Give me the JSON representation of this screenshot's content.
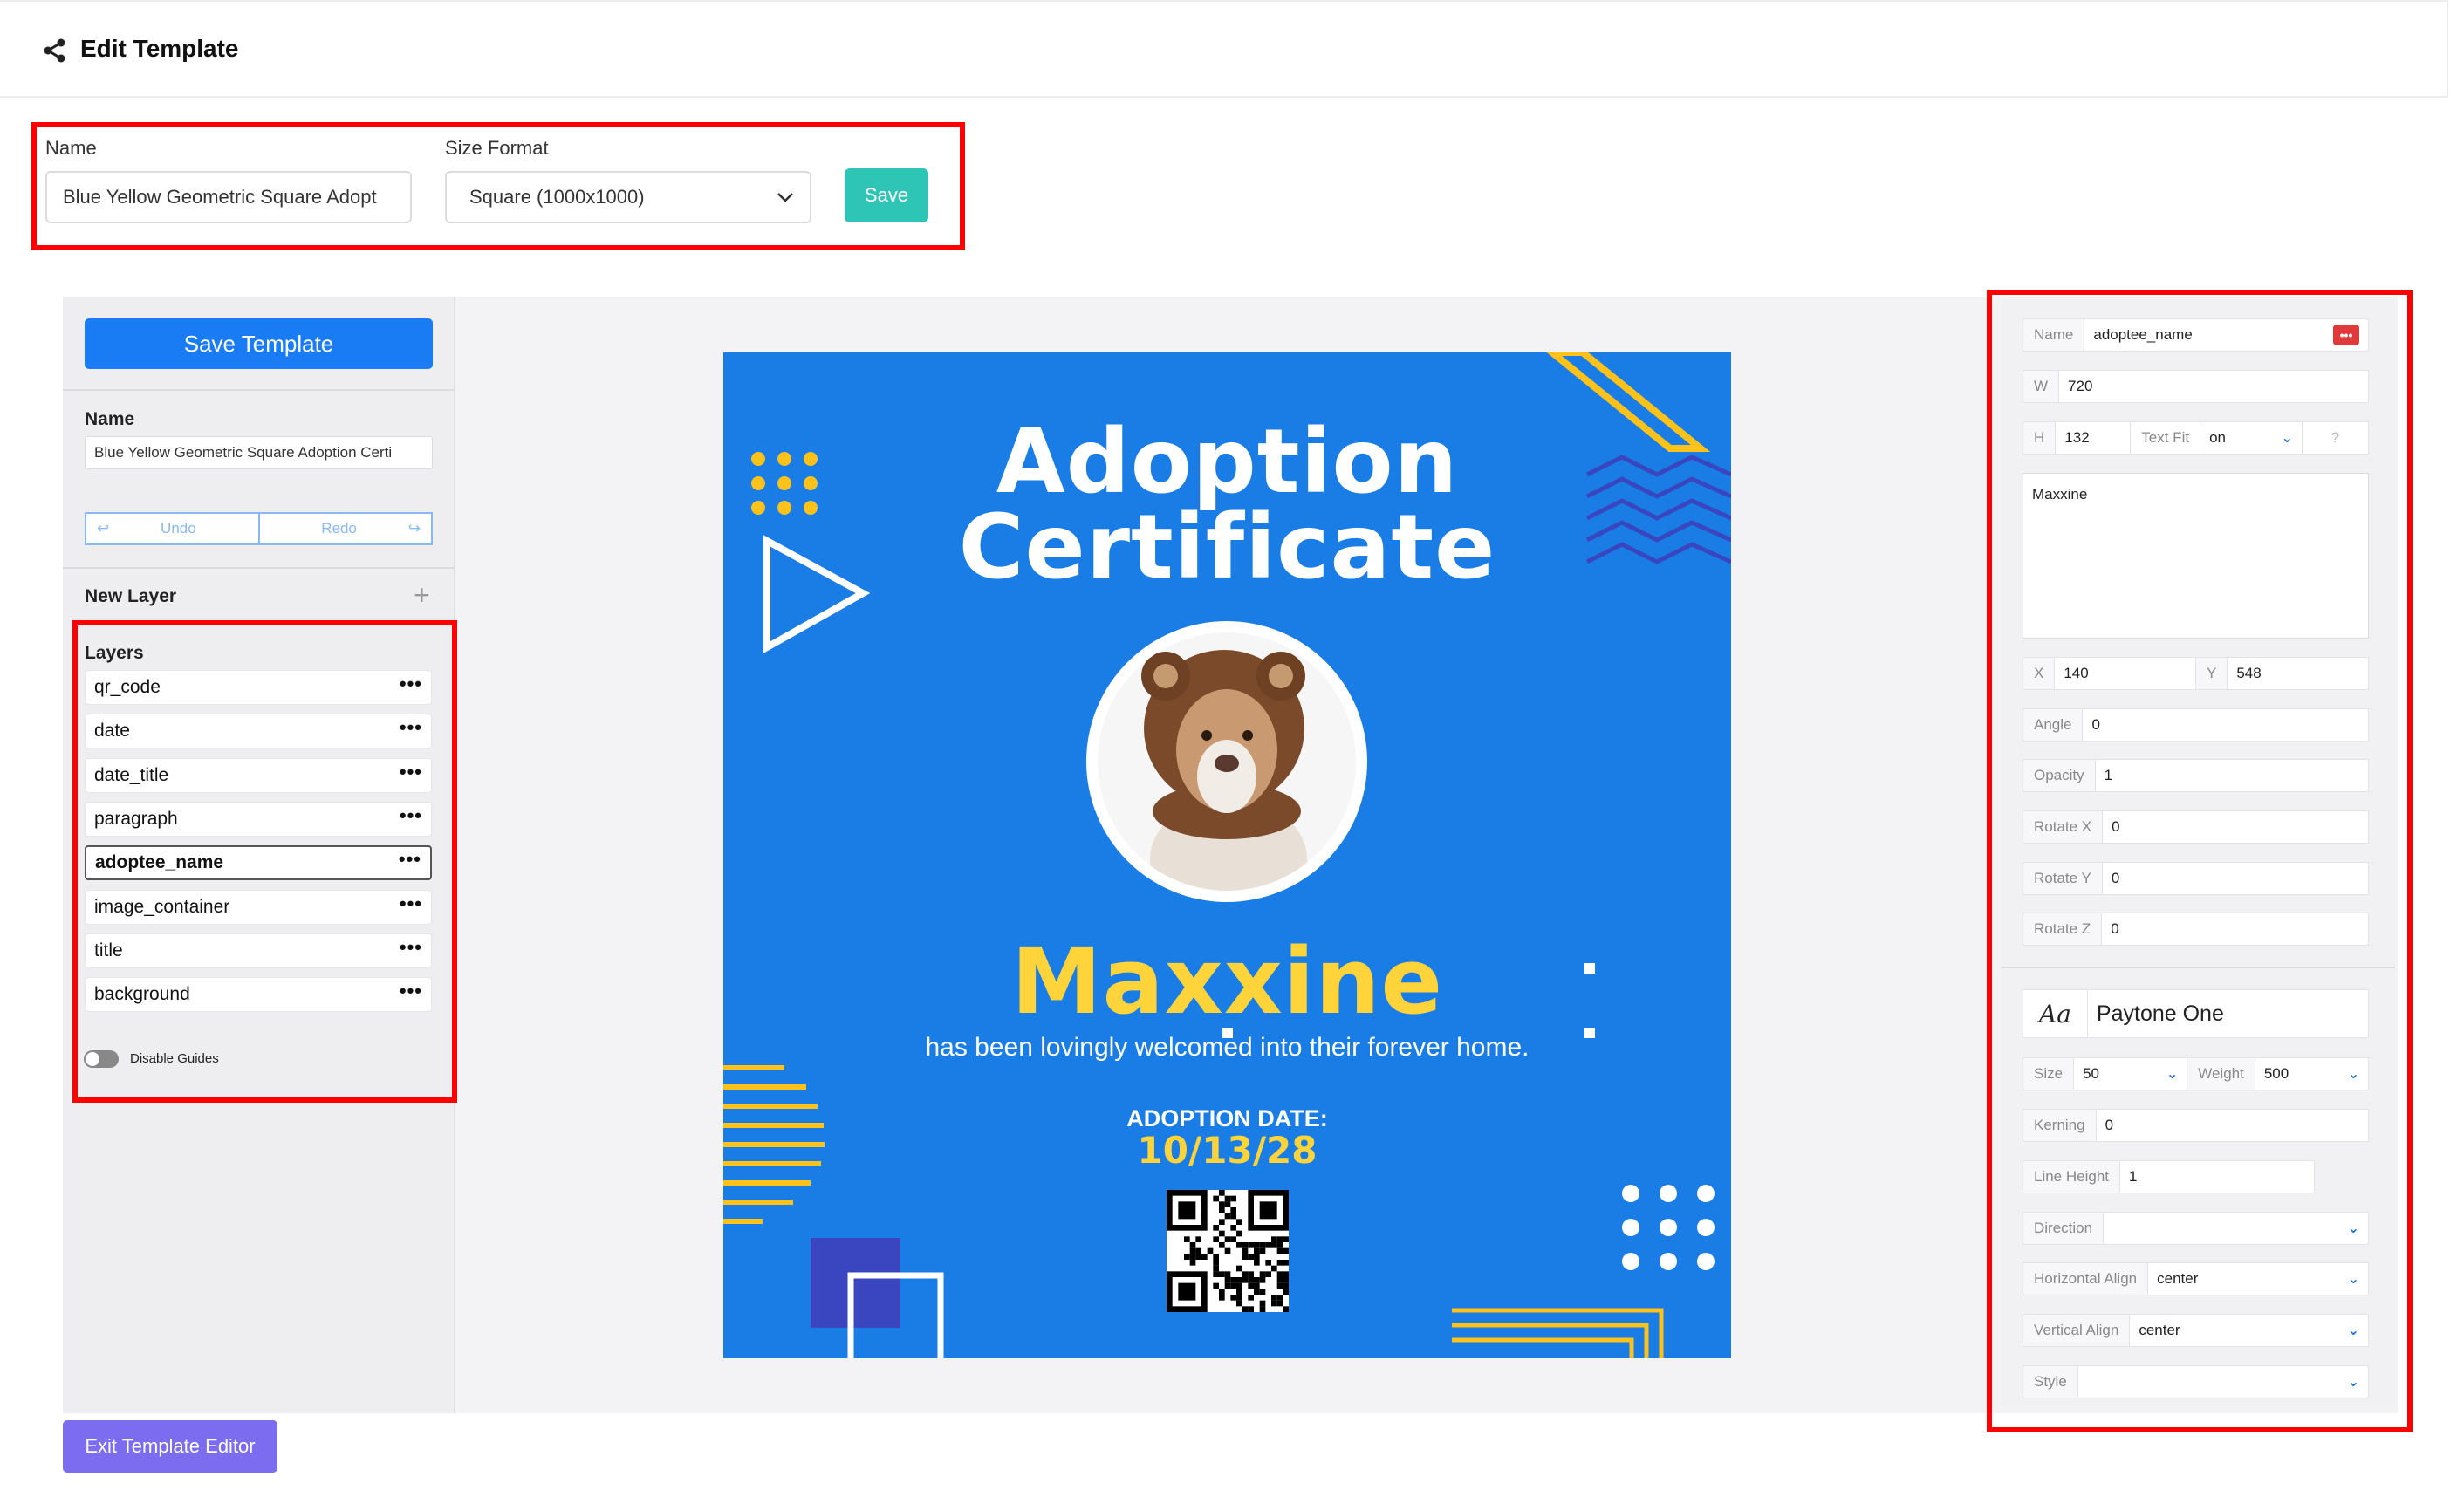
{
  "header": {
    "title": "Edit Template"
  },
  "form": {
    "name_label": "Name",
    "name_value": "Blue Yellow Geometric Square Adopt",
    "size_label": "Size Format",
    "size_value": "Square (1000x1000)",
    "save_label": "Save"
  },
  "left": {
    "save_template": "Save Template",
    "name_label": "Name",
    "name_value": "Blue Yellow Geometric Square Adoption Certi",
    "undo": "Undo",
    "redo": "Redo",
    "new_layer": "New Layer",
    "layers_label": "Layers",
    "layers": [
      "qr_code",
      "date",
      "date_title",
      "paragraph",
      "adoptee_name",
      "image_container",
      "title",
      "background"
    ],
    "selected_layer": "adoptee_name",
    "disable_guides": "Disable Guides",
    "exit": "Exit Template Editor"
  },
  "canvas": {
    "title_line1": "Adoption",
    "title_line2": "Certificate",
    "name": "Maxxine",
    "paragraph": "has been lovingly welcomed into their forever home.",
    "date_title": "ADOPTION DATE:",
    "date_value": "10/13/28",
    "colors": {
      "bg": "#1a7de6",
      "accent": "#ffd43b",
      "navy": "#3a45c0"
    }
  },
  "right": {
    "name_label": "Name",
    "name_value": "adoptee_name",
    "w_label": "W",
    "w_value": "720",
    "h_label": "H",
    "h_value": "132",
    "textfit_label": "Text Fit",
    "textfit_value": "on",
    "text_value": "Maxxine",
    "x_label": "X",
    "x_value": "140",
    "y_label": "Y",
    "y_value": "548",
    "angle_label": "Angle",
    "angle_value": "0",
    "opacity_label": "Opacity",
    "opacity_value": "1",
    "rotx_label": "Rotate X",
    "rotx_value": "0",
    "roty_label": "Rotate Y",
    "roty_value": "0",
    "rotz_label": "Rotate Z",
    "rotz_value": "0",
    "font_icon": "Aa",
    "font_value": "Paytone One",
    "size_label": "Size",
    "size_value": "50",
    "weight_label": "Weight",
    "weight_value": "500",
    "kerning_label": "Kerning",
    "kerning_value": "0",
    "lineheight_label": "Line Height",
    "lineheight_value": "1",
    "direction_label": "Direction",
    "direction_value": "",
    "halign_label": "Horizontal Align",
    "halign_value": "center",
    "valign_label": "Vertical Align",
    "valign_value": "center",
    "style_label": "Style",
    "style_value": ""
  }
}
